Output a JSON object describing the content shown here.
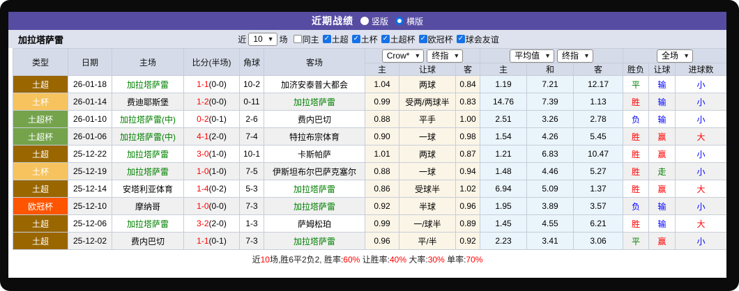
{
  "title_bar": {
    "title": "近期战绩",
    "radios": [
      {
        "label": "竖版",
        "selected": false
      },
      {
        "label": "横版",
        "selected": true
      }
    ]
  },
  "filter": {
    "team": "加拉塔萨雷",
    "near_label": "近",
    "match_count": "10",
    "games_label": "场",
    "same_home": {
      "label": "同主",
      "checked": false
    },
    "leagues": [
      {
        "label": "土超",
        "checked": true
      },
      {
        "label": "土杯",
        "checked": true
      },
      {
        "label": "土超杯",
        "checked": true
      },
      {
        "label": "欧冠杯",
        "checked": true
      },
      {
        "label": "球会友谊",
        "checked": true
      }
    ]
  },
  "header": {
    "main_cols": [
      "类型",
      "日期",
      "主场",
      "比分(半场)",
      "角球",
      "客场"
    ],
    "selects": {
      "odds_source": "Crow*",
      "odds_stage": "终指",
      "avg_source": "平均值",
      "avg_stage": "终指",
      "scope": "全场"
    },
    "sub_cols": [
      "主",
      "让球",
      "客",
      "主",
      "和",
      "客",
      "胜负",
      "让球",
      "进球数"
    ]
  },
  "colors": {
    "titlebar_purple": "#564CA2",
    "header_bg": "#D5DBE8",
    "filter_bg": "#DDE2EE",
    "row_alt": "#F0F0F0",
    "handicap_bg": "#FBF5E7",
    "avg_bg": "#EAF4FB",
    "team_green": "#008000",
    "score_red": "#FF0000",
    "stat_red": "#FF0000",
    "grid_line": "#C6CDD9",
    "type_colors": {
      "土超": "#996600",
      "土杯": "#F6C35E",
      "土超杯": "#74A34C",
      "欧冠杯": "#FF5500"
    },
    "value_colors": {
      "胜": "#FF0000",
      "平": "#008000",
      "负": "#0000FF",
      "赢": "#FF0000",
      "输": "#0000FF",
      "走": "#008000",
      "大": "#FF0000",
      "小": "#0000FF"
    }
  },
  "rows": [
    {
      "type": "土超",
      "date": "26-01-18",
      "home": "加拉塔萨雷",
      "home_green": true,
      "score": "1-1",
      "half": "(0-0)",
      "corner": "10-2",
      "away": "加济安泰普大都会",
      "away_green": false,
      "h_home": "1.04",
      "h_line": "两球",
      "h_away": "0.84",
      "a_home": "1.19",
      "a_draw": "7.21",
      "a_away": "12.17",
      "wl": "平",
      "hc": "输",
      "goals": "小"
    },
    {
      "type": "土杯",
      "date": "26-01-14",
      "home": "费迪耶斯堡",
      "home_green": false,
      "score": "1-2",
      "half": "(0-0)",
      "corner": "0-11",
      "away": "加拉塔萨雷",
      "away_green": true,
      "h_home": "0.99",
      "h_line": "受两/两球半",
      "h_away": "0.83",
      "a_home": "14.76",
      "a_draw": "7.39",
      "a_away": "1.13",
      "wl": "胜",
      "hc": "输",
      "goals": "小"
    },
    {
      "type": "土超杯",
      "date": "26-01-10",
      "home": "加拉塔萨雷(中)",
      "home_green": true,
      "score": "0-2",
      "half": "(0-1)",
      "corner": "2-6",
      "away": "费内巴切",
      "away_green": false,
      "h_home": "0.88",
      "h_line": "平手",
      "h_away": "1.00",
      "a_home": "2.51",
      "a_draw": "3.26",
      "a_away": "2.78",
      "wl": "负",
      "hc": "输",
      "goals": "小"
    },
    {
      "type": "土超杯",
      "date": "26-01-06",
      "home": "加拉塔萨雷(中)",
      "home_green": true,
      "score": "4-1",
      "half": "(2-0)",
      "corner": "7-4",
      "away": "特拉布宗体育",
      "away_green": false,
      "h_home": "0.90",
      "h_line": "一球",
      "h_away": "0.98",
      "a_home": "1.54",
      "a_draw": "4.26",
      "a_away": "5.45",
      "wl": "胜",
      "hc": "赢",
      "goals": "大"
    },
    {
      "type": "土超",
      "date": "25-12-22",
      "home": "加拉塔萨雷",
      "home_green": true,
      "score": "3-0",
      "half": "(1-0)",
      "corner": "10-1",
      "away": "卡斯帕萨",
      "away_green": false,
      "h_home": "1.01",
      "h_line": "两球",
      "h_away": "0.87",
      "a_home": "1.21",
      "a_draw": "6.83",
      "a_away": "10.47",
      "wl": "胜",
      "hc": "赢",
      "goals": "小"
    },
    {
      "type": "土杯",
      "date": "25-12-19",
      "home": "加拉塔萨雷",
      "home_green": true,
      "score": "1-0",
      "half": "(1-0)",
      "corner": "7-5",
      "away": "伊斯坦布尔巴萨克塞尔",
      "away_green": false,
      "h_home": "0.88",
      "h_line": "一球",
      "h_away": "0.94",
      "a_home": "1.48",
      "a_draw": "4.46",
      "a_away": "5.27",
      "wl": "胜",
      "hc": "走",
      "goals": "小"
    },
    {
      "type": "土超",
      "date": "25-12-14",
      "home": "安塔利亚体育",
      "home_green": false,
      "score": "1-4",
      "half": "(0-2)",
      "corner": "5-3",
      "away": "加拉塔萨雷",
      "away_green": true,
      "h_home": "0.86",
      "h_line": "受球半",
      "h_away": "1.02",
      "a_home": "6.94",
      "a_draw": "5.09",
      "a_away": "1.37",
      "wl": "胜",
      "hc": "赢",
      "goals": "大"
    },
    {
      "type": "欧冠杯",
      "date": "25-12-10",
      "home": "摩纳哥",
      "home_green": false,
      "score": "1-0",
      "half": "(0-0)",
      "corner": "7-3",
      "away": "加拉塔萨雷",
      "away_green": true,
      "h_home": "0.92",
      "h_line": "半球",
      "h_away": "0.96",
      "a_home": "1.95",
      "a_draw": "3.89",
      "a_away": "3.57",
      "wl": "负",
      "hc": "输",
      "goals": "小"
    },
    {
      "type": "土超",
      "date": "25-12-06",
      "home": "加拉塔萨雷",
      "home_green": true,
      "score": "3-2",
      "half": "(2-0)",
      "corner": "1-3",
      "away": "萨姆松珀",
      "away_green": false,
      "h_home": "0.99",
      "h_line": "一/球半",
      "h_away": "0.89",
      "a_home": "1.45",
      "a_draw": "4.55",
      "a_away": "6.21",
      "wl": "胜",
      "hc": "输",
      "goals": "大"
    },
    {
      "type": "土超",
      "date": "25-12-02",
      "home": "费内巴切",
      "home_green": false,
      "score": "1-1",
      "half": "(0-1)",
      "corner": "7-3",
      "away": "加拉塔萨雷",
      "away_green": true,
      "h_home": "0.96",
      "h_line": "平/半",
      "h_away": "0.92",
      "a_home": "2.23",
      "a_draw": "3.41",
      "a_away": "3.06",
      "wl": "平",
      "hc": "赢",
      "goals": "小"
    }
  ],
  "footer": {
    "parts": [
      {
        "text": "近",
        "red": false
      },
      {
        "text": "10",
        "red": true
      },
      {
        "text": "场,胜6平2负2, 胜率:",
        "red": false
      },
      {
        "text": "60%",
        "red": true
      },
      {
        "text": " 让胜率:",
        "red": false
      },
      {
        "text": "40%",
        "red": true
      },
      {
        "text": " 大率:",
        "red": false
      },
      {
        "text": "30%",
        "red": true
      },
      {
        "text": " 单率:",
        "red": false
      },
      {
        "text": "70%",
        "red": true
      }
    ]
  }
}
